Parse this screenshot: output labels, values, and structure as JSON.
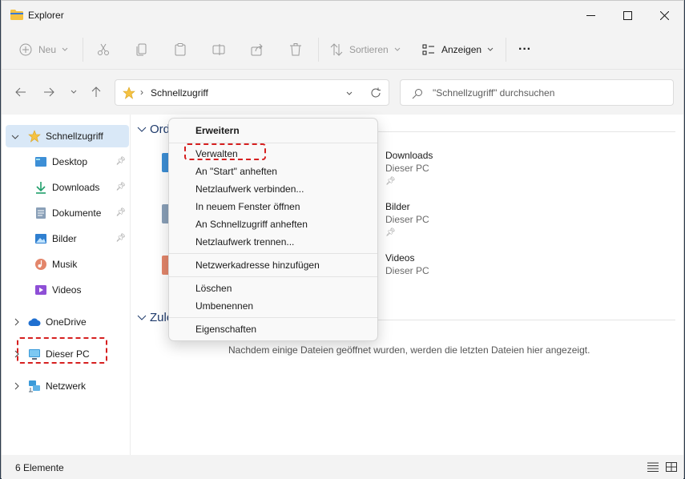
{
  "window": {
    "title": "Explorer",
    "minimize": "—",
    "maximize": "☐",
    "close": "✕"
  },
  "toolbar": {
    "new_label": "Neu",
    "sort_label": "Sortieren",
    "view_label": "Anzeigen",
    "more_label": "···"
  },
  "address": {
    "path": "Schnellzugriff",
    "search_placeholder": "\"Schnellzugriff\" durchsuchen"
  },
  "sidebar": {
    "quick_access": "Schnellzugriff",
    "items": [
      {
        "label": "Desktop",
        "icon": "desktop-icon"
      },
      {
        "label": "Downloads",
        "icon": "download-icon"
      },
      {
        "label": "Dokumente",
        "icon": "document-icon"
      },
      {
        "label": "Bilder",
        "icon": "picture-icon"
      },
      {
        "label": "Musik",
        "icon": "music-icon"
      },
      {
        "label": "Videos",
        "icon": "video-icon"
      }
    ],
    "onedrive": "OneDrive",
    "this_pc": "Dieser PC",
    "network": "Netzwerk"
  },
  "main": {
    "section_folders": "Ord",
    "section_recent": "Zule",
    "folders": [
      {
        "name": "Downloads",
        "location": "Dieser PC"
      },
      {
        "name": "Bilder",
        "location": "Dieser PC"
      },
      {
        "name": "Videos",
        "location": "Dieser PC"
      }
    ],
    "empty_recent": "Nachdem einige Dateien geöffnet wurden, werden die letzten Dateien hier angezeigt."
  },
  "status": {
    "item_count": "6 Elemente"
  },
  "context_menu": {
    "items": [
      "Erweitern",
      "Verwalten",
      "An \"Start\" anheften",
      "Netzlaufwerk verbinden...",
      "In neuem Fenster öffnen",
      "An Schnellzugriff anheften",
      "Netzlaufwerk trennen...",
      "Netzwerkadresse hinzufügen",
      "Löschen",
      "Umbenennen",
      "Eigenschaften"
    ]
  },
  "colors": {
    "highlight": "#d62020",
    "selection": "#d9e8f7",
    "section_heading": "#1e3a6b"
  }
}
